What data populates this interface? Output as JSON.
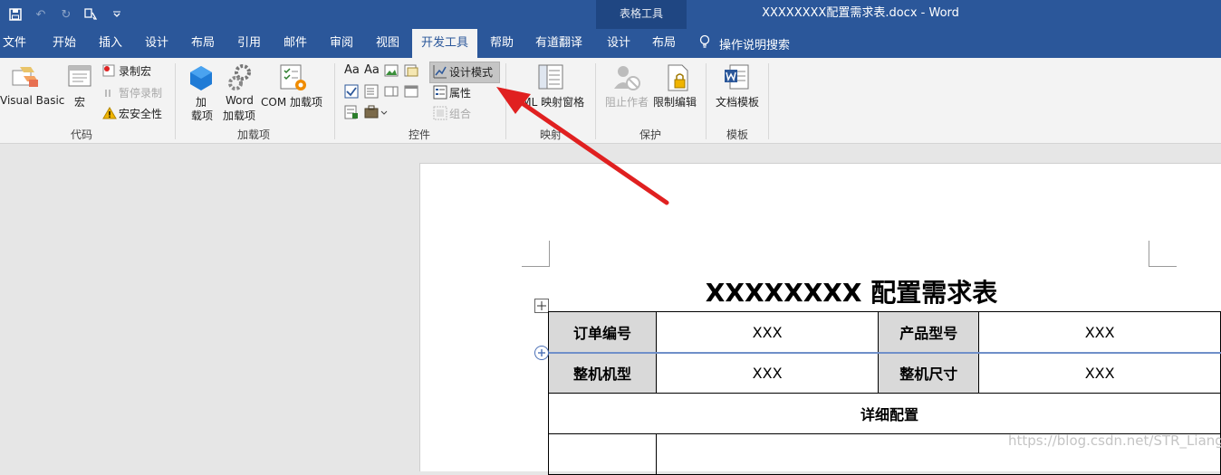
{
  "window": {
    "document_title": "XXXXXXXX配置需求表.docx  -  Word",
    "context_group_label": "表格工具",
    "accent_color": "#2b579a"
  },
  "menu_tabs": [
    "文件",
    "开始",
    "插入",
    "设计",
    "布局",
    "引用",
    "邮件",
    "审阅",
    "视图",
    "开发工具",
    "帮助",
    "有道翻译",
    "设计",
    "布局"
  ],
  "tell_me": "操作说明搜索",
  "ribbon": {
    "code": {
      "visual_basic": "Visual Basic",
      "macros": "宏",
      "record_macro": "录制宏",
      "pause_recording": "暂停录制",
      "macro_security": "宏安全性",
      "group_label": "代码"
    },
    "addins": {
      "add_label_line1": "加",
      "add_label_line2": "载项",
      "word_label_line1": "Word",
      "word_label_line2": "加载项",
      "com_label": "COM 加载项",
      "group_label": "加载项"
    },
    "controls": {
      "design_mode": "设计模式",
      "properties": "属性",
      "group": "组合",
      "group_label": "控件"
    },
    "mapping": {
      "xml_pane": "XML 映射窗格",
      "group_label": "映射"
    },
    "protect": {
      "block_authors": "阻止作者",
      "restrict_editing": "限制编辑",
      "group_label": "保护"
    },
    "templates": {
      "document_template": "文档模板",
      "group_label": "模板"
    }
  },
  "document": {
    "title": "XXXXXXXX 配置需求表",
    "table": {
      "row1": [
        "订单编号",
        "XXX",
        "产品型号",
        "XXX"
      ],
      "row2": [
        "整机机型",
        "XXX",
        "整机尺寸",
        "XXX"
      ],
      "section_header": "详细配置"
    }
  },
  "watermark": "https://blog.csdn.net/STR_Liang",
  "annotation": {
    "arrow_color": "#e02020"
  }
}
